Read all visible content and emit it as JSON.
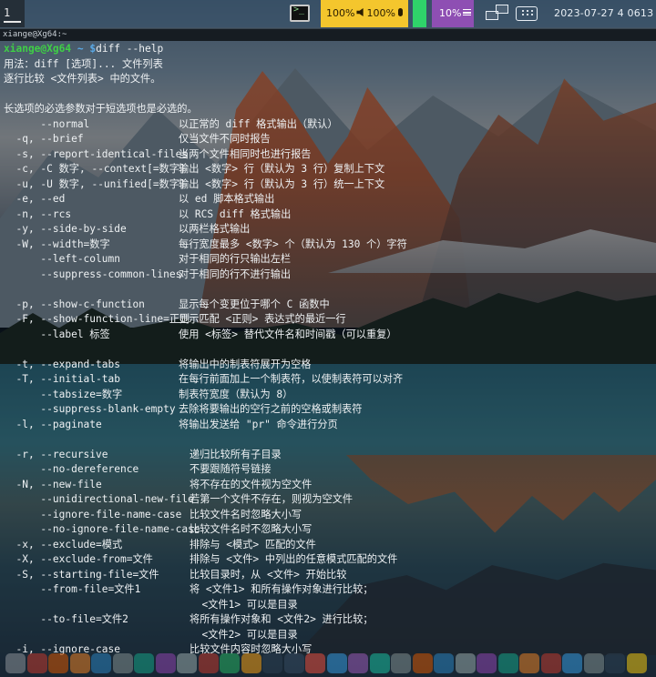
{
  "panel": {
    "workspace_label": "1",
    "volume_text": "100%",
    "mic_text": "100%",
    "brightness_text": "10%",
    "datetime": "2023-07-27 4 0613",
    "colors": {
      "yellow": "#f4c62d",
      "green": "#2fd36a",
      "purple": "#8e4fb3"
    }
  },
  "terminal": {
    "title": "xiange@Xg64:~",
    "prompt": {
      "user_host": "xiange@Xg64",
      "path": "~",
      "symbol": "$",
      "command": "diff --help"
    },
    "intro": [
      "用法：diff [选项]... 文件列表",
      "逐行比较 <文件列表> 中的文件。",
      "",
      "长选项的必选参数对于短选项也是必选的。"
    ],
    "options": [
      {
        "opt": "      --normal",
        "desc": "以正常的 diff 格式输出（默认）"
      },
      {
        "opt": "  -q, --brief",
        "desc": "仅当文件不同时报告"
      },
      {
        "opt": "  -s, --report-identical-files",
        "desc": "当两个文件相同时也进行报告"
      },
      {
        "opt": "  -c, -C 数字, --context[=数字]",
        "desc": "输出 <数字> 行（默认为 3 行）复制上下文"
      },
      {
        "opt": "  -u, -U 数字, --unified[=数字]",
        "desc": "输出 <数字> 行（默认为 3 行）统一上下文"
      },
      {
        "opt": "  -e, --ed",
        "desc": "以 ed 脚本格式输出"
      },
      {
        "opt": "  -n, --rcs",
        "desc": "以 RCS diff 格式输出"
      },
      {
        "opt": "  -y, --side-by-side",
        "desc": "以两栏格式输出"
      },
      {
        "opt": "  -W, --width=数字",
        "desc": "每行宽度最多 <数字> 个（默认为 130 个）字符"
      },
      {
        "opt": "      --left-column",
        "desc": "对于相同的行只输出左栏"
      },
      {
        "opt": "      --suppress-common-lines",
        "desc": "对于相同的行不进行输出"
      },
      {
        "opt": "",
        "desc": ""
      },
      {
        "opt": "  -p, --show-c-function",
        "desc": "显示每个变更位于哪个 C 函数中"
      },
      {
        "opt": "  -F, --show-function-line=正则",
        "desc": "显示匹配 <正则> 表达式的最近一行"
      },
      {
        "opt": "      --label 标签",
        "desc": "使用 <标签> 替代文件名和时间戳（可以重复）"
      },
      {
        "opt": "",
        "desc": ""
      },
      {
        "opt": "  -t, --expand-tabs",
        "desc": "将输出中的制表符展开为空格"
      },
      {
        "opt": "  -T, --initial-tab",
        "desc": "在每行前面加上一个制表符，以使制表符可以对齐"
      },
      {
        "opt": "      --tabsize=数字",
        "desc": "制表符宽度（默认为 8）"
      },
      {
        "opt": "      --suppress-blank-empty",
        "desc": "去除将要输出的空行之前的空格或制表符"
      },
      {
        "opt": "  -l, --paginate",
        "desc": "将输出发送给 \"pr\" 命令进行分页"
      },
      {
        "opt": "",
        "desc": ""
      },
      {
        "opt": "  -r, --recursive",
        "desc": "递归比较所有子目录",
        "wide": true
      },
      {
        "opt": "      --no-dereference",
        "desc": "不要跟随符号链接",
        "wide": true
      },
      {
        "opt": "  -N, --new-file",
        "desc": "将不存在的文件视为空文件",
        "wide": true
      },
      {
        "opt": "      --unidirectional-new-file",
        "desc": "若第一个文件不存在，则视为空文件",
        "wide": true
      },
      {
        "opt": "      --ignore-file-name-case",
        "desc": "比较文件名时忽略大小写",
        "wide": true
      },
      {
        "opt": "      --no-ignore-file-name-case",
        "desc": "比较文件名时不忽略大小写",
        "wide": true
      },
      {
        "opt": "  -x, --exclude=模式",
        "desc": "排除与 <模式> 匹配的文件",
        "wide": true
      },
      {
        "opt": "  -X, --exclude-from=文件",
        "desc": "排除与 <文件> 中列出的任意模式匹配的文件",
        "wide": true
      },
      {
        "opt": "  -S, --starting-file=文件",
        "desc": "比较目录时，从 <文件> 开始比较",
        "wide": true
      },
      {
        "opt": "      --from-file=文件1",
        "desc": "将 <文件1> 和所有操作对象进行比较；",
        "wide": true
      },
      {
        "opt": "",
        "desc": "  <文件1> 可以是目录",
        "wide": true
      },
      {
        "opt": "      --to-file=文件2",
        "desc": "将所有操作对象和 <文件2> 进行比较；",
        "wide": true
      },
      {
        "opt": "",
        "desc": "  <文件2> 可以是目录",
        "wide": true
      },
      {
        "opt": "  -i, --ignore-case",
        "desc": "比较文件内容时忽略大小写",
        "wide": true
      }
    ]
  }
}
